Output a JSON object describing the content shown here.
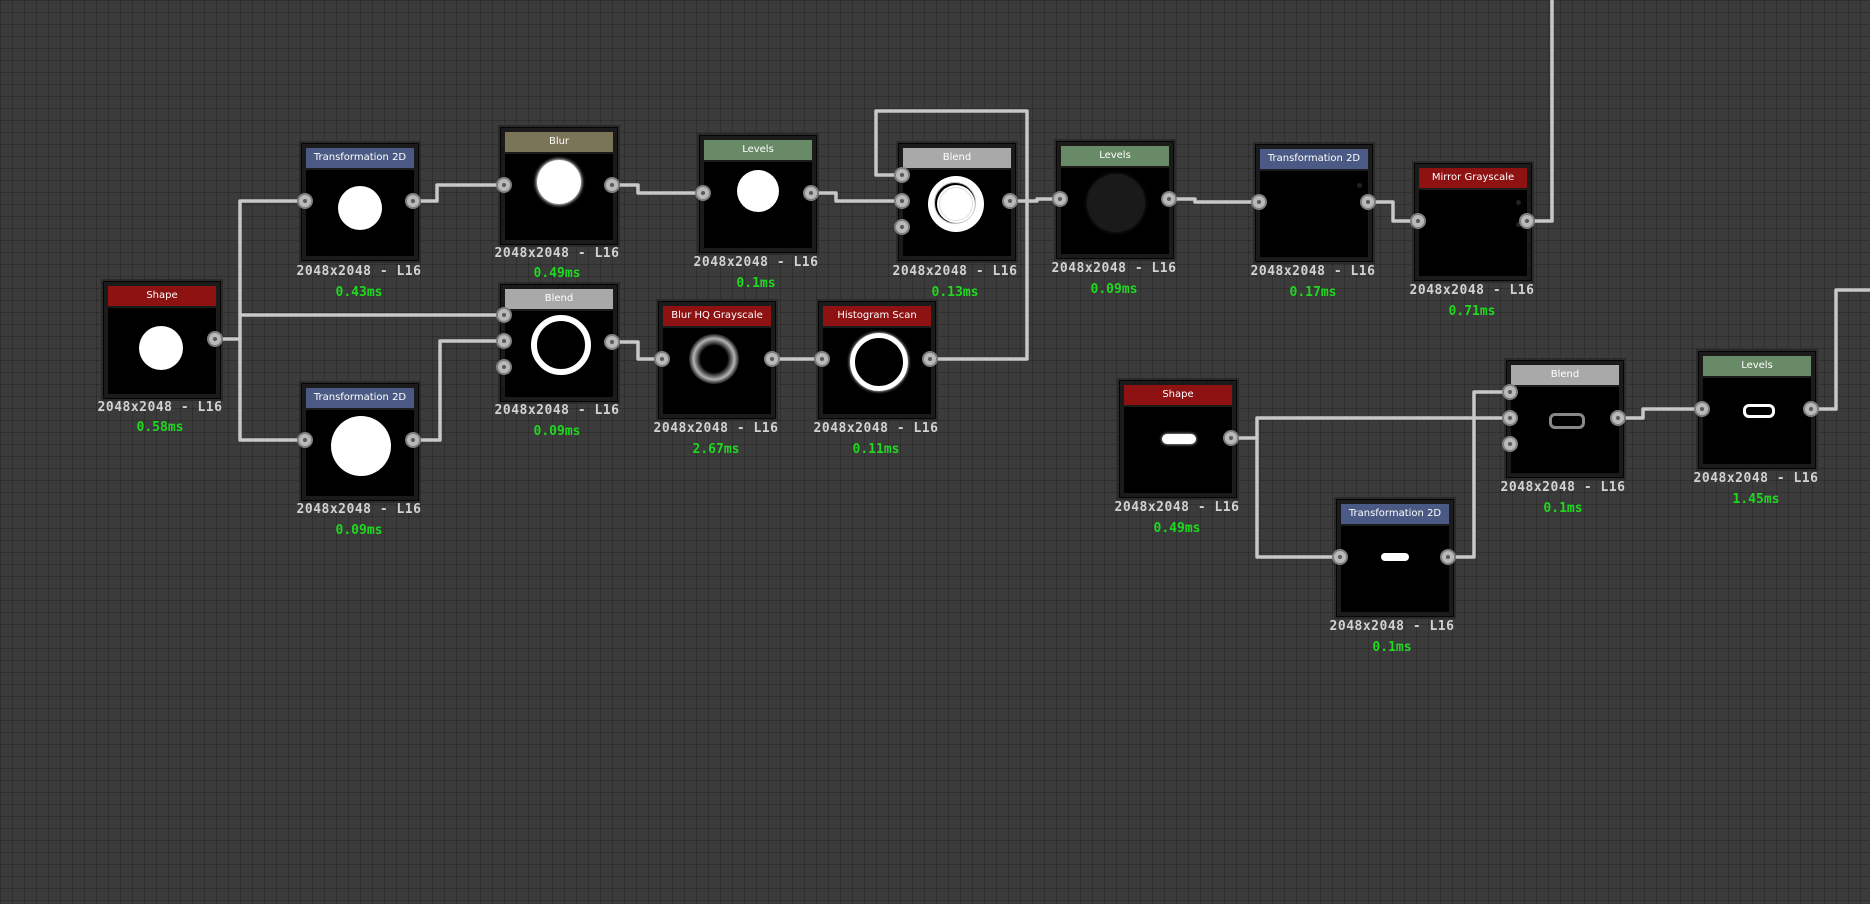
{
  "colors": {
    "background": "#3b3b3b",
    "wire": "#c8c8c8",
    "header_red": "#8e1212",
    "header_blue": "#4b5a84",
    "header_tan": "#7a7458",
    "header_green": "#698a66",
    "header_gray": "#a9a9a9",
    "timing_text": "#1fd81f"
  },
  "nodes": [
    {
      "id": "n1",
      "title": "Shape",
      "header_color": "#8e1212",
      "resolution": "2048x2048 - L16",
      "time": "0.58ms"
    },
    {
      "id": "n2",
      "title": "Transformation 2D",
      "header_color": "#4b5a84",
      "resolution": "2048x2048 - L16",
      "time": "0.43ms"
    },
    {
      "id": "n3",
      "title": "Transformation 2D",
      "header_color": "#4b5a84",
      "resolution": "2048x2048 - L16",
      "time": "0.09ms"
    },
    {
      "id": "n4",
      "title": "Blur",
      "header_color": "#7a7458",
      "resolution": "2048x2048 - L16",
      "time": "0.49ms"
    },
    {
      "id": "n5",
      "title": "Blend",
      "header_color": "#a9a9a9",
      "resolution": "2048x2048 - L16",
      "time": "0.09ms"
    },
    {
      "id": "n6",
      "title": "Levels",
      "header_color": "#698a66",
      "resolution": "2048x2048 - L16",
      "time": "0.1ms"
    },
    {
      "id": "n7",
      "title": "Blur HQ Grayscale",
      "header_color": "#8e1212",
      "resolution": "2048x2048 - L16",
      "time": "2.67ms"
    },
    {
      "id": "n8",
      "title": "Histogram Scan",
      "header_color": "#8e1212",
      "resolution": "2048x2048 - L16",
      "time": "0.11ms"
    },
    {
      "id": "n9",
      "title": "Blend",
      "header_color": "#a9a9a9",
      "resolution": "2048x2048 - L16",
      "time": "0.13ms"
    },
    {
      "id": "n10",
      "title": "Levels",
      "header_color": "#698a66",
      "resolution": "2048x2048 - L16",
      "time": "0.09ms"
    },
    {
      "id": "n11",
      "title": "Transformation 2D",
      "header_color": "#4b5a84",
      "resolution": "2048x2048 - L16",
      "time": "0.17ms"
    },
    {
      "id": "n12",
      "title": "Mirror Grayscale",
      "header_color": "#8e1212",
      "resolution": "2048x2048 - L16",
      "time": "0.71ms"
    },
    {
      "id": "n13",
      "title": "Shape",
      "header_color": "#8e1212",
      "resolution": "2048x2048 - L16",
      "time": "0.49ms"
    },
    {
      "id": "n14",
      "title": "Transformation 2D",
      "header_color": "#4b5a84",
      "resolution": "2048x2048 - L16",
      "time": "0.1ms"
    },
    {
      "id": "n15",
      "title": "Blend",
      "header_color": "#a9a9a9",
      "resolution": "2048x2048 - L16",
      "time": "0.1ms"
    },
    {
      "id": "n16",
      "title": "Levels",
      "header_color": "#698a66",
      "resolution": "2048x2048 - L16",
      "time": "1.45ms"
    }
  ]
}
